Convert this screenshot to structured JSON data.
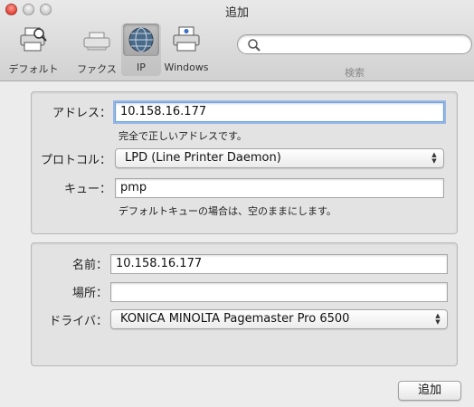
{
  "window": {
    "title": "追加"
  },
  "toolbar": {
    "tools": [
      {
        "label": "デフォルト",
        "icon": "printer-default-icon",
        "selected": false
      },
      {
        "label": "ファクス",
        "icon": "fax-icon",
        "selected": false
      },
      {
        "label": "IP",
        "icon": "globe-icon",
        "selected": true
      },
      {
        "label": "Windows",
        "icon": "windows-printer-icon",
        "selected": false
      }
    ],
    "search_placeholder": "",
    "search_label": "検索"
  },
  "ip_panel": {
    "address_label": "アドレス：",
    "address_value": "10.158.16.177",
    "address_hint": "完全で正しいアドレスです。",
    "protocol_label": "プロトコル：",
    "protocol_value": "LPD (Line Printer Daemon)",
    "queue_label": "キュー：",
    "queue_value": "pmp",
    "queue_hint": "デフォルトキューの場合は、空のままにします。"
  },
  "printer_panel": {
    "name_label": "名前：",
    "name_value": "10.158.16.177",
    "location_label": "場所：",
    "location_value": "",
    "driver_label": "ドライバ：",
    "driver_value": "KONICA MINOLTA Pagemaster Pro 6500"
  },
  "actions": {
    "add_label": "追加"
  },
  "colors": {
    "focus_ring": "#6aa0e0",
    "close_button": "#e0443a"
  }
}
